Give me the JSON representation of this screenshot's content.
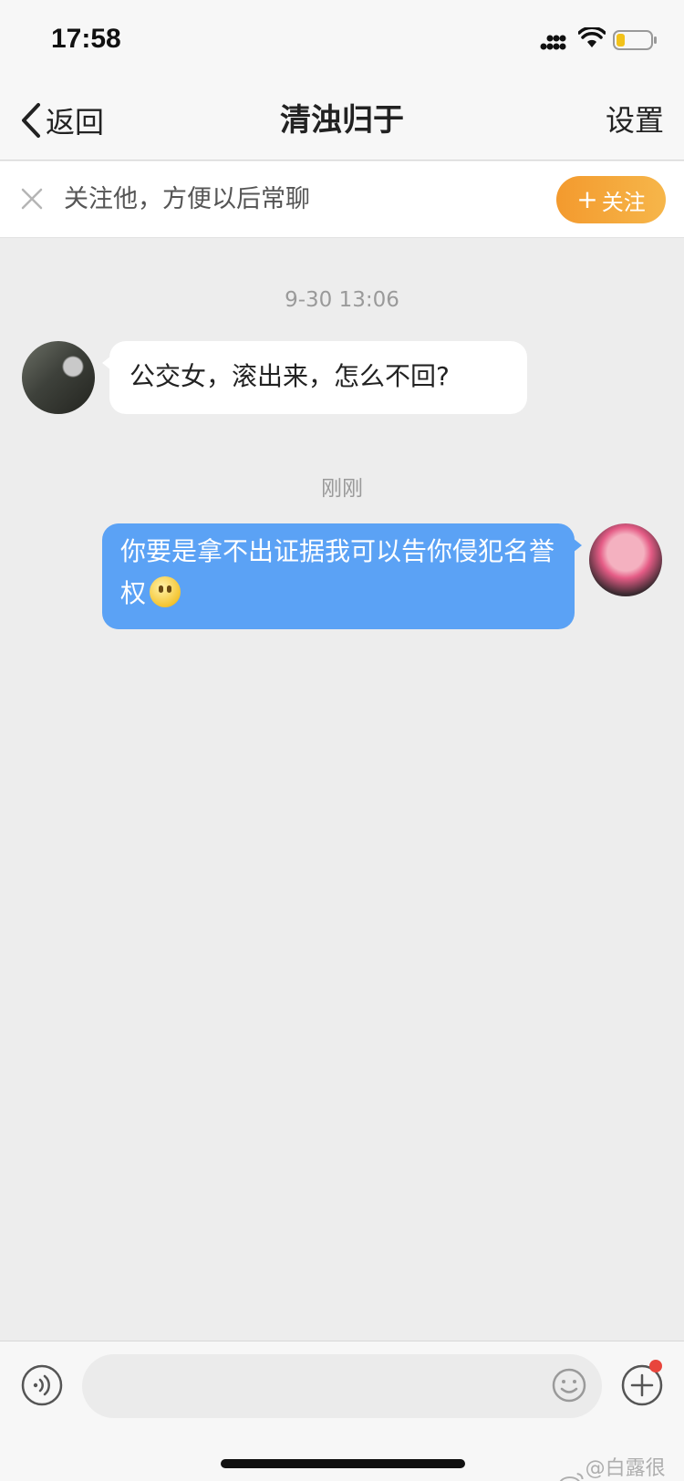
{
  "status_bar": {
    "time": "17:58"
  },
  "nav": {
    "back_label": "返回",
    "title": "清浊归于",
    "settings_label": "设置"
  },
  "follow_banner": {
    "text": "关注他，方便以后常聊",
    "button_label": "关注"
  },
  "messages": [
    {
      "timestamp": "9-30 13:06",
      "sender": "other",
      "text": "公交女，滚出来，怎么不回?"
    },
    {
      "timestamp": "刚刚",
      "sender": "self",
      "text": "你要是拿不出证据我可以告你侵犯名誉权",
      "emoji": "smiley-face"
    }
  ],
  "input": {
    "placeholder": "",
    "value": ""
  },
  "watermark": {
    "text": "@白露很白"
  },
  "colors": {
    "accent_orange": "#f39a2e",
    "outgoing_bubble": "#5ba2f5",
    "incoming_bubble": "#ffffff",
    "background": "#ededed",
    "notification_dot": "#e8453c"
  },
  "icons": [
    "signal-icon",
    "wifi-icon",
    "battery-icon",
    "back-chevron-icon",
    "close-icon",
    "voice-icon",
    "emoji-icon",
    "plus-circle-icon",
    "weibo-icon"
  ]
}
